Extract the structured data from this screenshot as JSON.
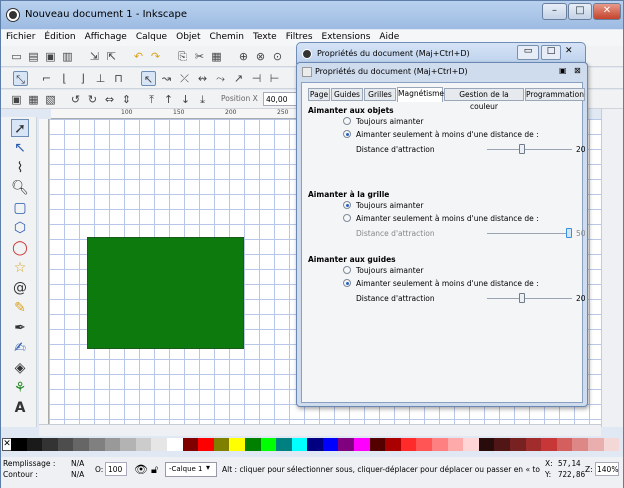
{
  "window": {
    "title": "Nouveau document 1 - Inkscape",
    "minimize": "–",
    "maximize": "□",
    "close": "✕"
  },
  "menu": [
    "Fichier",
    "Édition",
    "Affichage",
    "Calque",
    "Objet",
    "Chemin",
    "Texte",
    "Filtres",
    "Extensions",
    "Aide"
  ],
  "toolbar": {
    "position_label": "Position X",
    "position_value": "40,00"
  },
  "dialog_back": {
    "title": "Propriétés du document (Maj+Ctrl+D)"
  },
  "dialog": {
    "title": "Propriétés du document (Maj+Ctrl+D)",
    "tabs": [
      "Page",
      "Guides",
      "Grilles",
      "Magnétisme",
      "Gestion de la couleur",
      "Programmation"
    ],
    "active_tab": "Magnétisme",
    "sections": [
      {
        "title": "Aimanter aux objets",
        "opt1": "Toujours aimanter",
        "opt1_selected": false,
        "opt2": "Aimanter seulement à moins d'une distance de :",
        "opt2_selected": true,
        "distance_label": "Distance d'attraction",
        "distance_value": "20",
        "distance_fraction": 0.4,
        "distance_enabled": true
      },
      {
        "title": "Aimanter à la grille",
        "opt1": "Toujours aimanter",
        "opt1_selected": true,
        "opt2": "Aimanter seulement à moins d'une distance de :",
        "opt2_selected": false,
        "distance_label": "Distance d'attraction",
        "distance_value": "50",
        "distance_fraction": 1.0,
        "distance_enabled": false
      },
      {
        "title": "Aimanter aux guides",
        "opt1": "Toujours aimanter",
        "opt1_selected": false,
        "opt2": "Aimanter seulement à moins d'une distance de :",
        "opt2_selected": true,
        "distance_label": "Distance d'attraction",
        "distance_value": "20",
        "distance_fraction": 0.4,
        "distance_enabled": true
      }
    ]
  },
  "ruler_ticks": [
    "100",
    "150",
    "200",
    "250"
  ],
  "palette": [
    "#000000",
    "#1a1a1a",
    "#333333",
    "#4d4d4d",
    "#666666",
    "#808080",
    "#999999",
    "#b3b3b3",
    "#cccccc",
    "#e6e6e6",
    "#ffffff",
    "#800000",
    "#ff0000",
    "#808000",
    "#ffff00",
    "#008000",
    "#00ff00",
    "#008080",
    "#00ffff",
    "#000080",
    "#0000ff",
    "#800080",
    "#ff00ff",
    "#550000",
    "#aa0000",
    "#ff2a2a",
    "#ff5555",
    "#ff8080",
    "#ffaaaa",
    "#ffd5d5",
    "#280b0b",
    "#501616",
    "#782121",
    "#a02c2c",
    "#c83737",
    "#d35f5f",
    "#de8787",
    "#e9afaf",
    "#f4d7d7"
  ],
  "status": {
    "fill_label": "Remplissage :",
    "fill_value": "N/A",
    "stroke_label": "Contour :",
    "stroke_value": "N/A",
    "opacity_label": "O:",
    "opacity_value": "100",
    "layer": "-Calque 1",
    "message": "Alt : cliquer pour sélectionner sous, cliquer-déplacer pour déplacer ou passer en « to",
    "x_label": "X:",
    "x_value": "57,14",
    "y_label": "Y:",
    "y_value": "722,86",
    "zoom_label": "Z:",
    "zoom_value": "140%"
  }
}
